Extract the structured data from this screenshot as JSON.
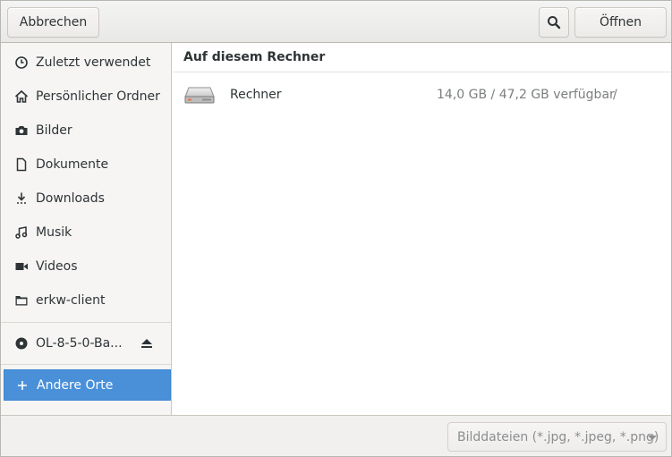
{
  "header": {
    "cancel_label": "Abbrechen",
    "open_label": "Öffnen"
  },
  "sidebar": {
    "items": [
      {
        "label": "Zuletzt verwendet",
        "icon": "recent-icon"
      },
      {
        "label": "Persönlicher Ordner",
        "icon": "home-icon"
      },
      {
        "label": "Bilder",
        "icon": "camera-icon"
      },
      {
        "label": "Dokumente",
        "icon": "document-icon"
      },
      {
        "label": "Downloads",
        "icon": "download-icon"
      },
      {
        "label": "Musik",
        "icon": "music-icon"
      },
      {
        "label": "Videos",
        "icon": "video-icon"
      },
      {
        "label": "erkw-client",
        "icon": "folder-icon"
      }
    ],
    "drive": {
      "label": "OL-8-5-0-Ba...",
      "icon": "optical-disc-icon"
    },
    "other": {
      "label": "Andere Orte",
      "icon": "plus-icon"
    }
  },
  "main": {
    "section_title": "Auf diesem Rechner",
    "location": {
      "name": "Rechner",
      "space": "14,0 GB / 47,2 GB verfügbar",
      "path": "/"
    }
  },
  "footer": {
    "filter_value": "Bilddateien (*.jpg, *.jpeg, *.png)"
  },
  "colors": {
    "selection": "#4a90d9",
    "sidebar_bg": "#f6f5f4",
    "text": "#2e3436",
    "dim_text": "#7b7e7f"
  }
}
